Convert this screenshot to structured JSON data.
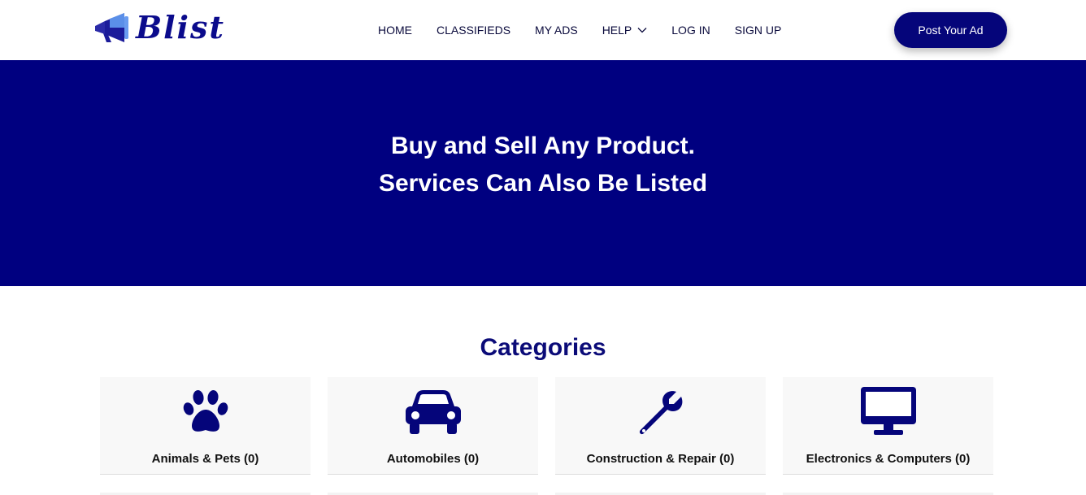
{
  "brand": {
    "name": "Blist",
    "color": "#0b0b8c"
  },
  "nav": {
    "items": [
      {
        "label": "HOME"
      },
      {
        "label": "CLASSIFIEDS"
      },
      {
        "label": "MY ADS"
      },
      {
        "label": "HELP"
      },
      {
        "label": "LOG IN"
      },
      {
        "label": "SIGN UP"
      }
    ],
    "post_button": "Post Your Ad"
  },
  "hero": {
    "line1": "Buy and Sell Any Product.",
    "line2": "Services Can Also Be Listed",
    "background": "#000080"
  },
  "categories": {
    "title": "Categories",
    "items": [
      {
        "label": "Animals & Pets (0)",
        "icon": "paw-icon"
      },
      {
        "label": "Automobiles (0)",
        "icon": "car-icon"
      },
      {
        "label": "Construction & Repair (0)",
        "icon": "wrench-icon"
      },
      {
        "label": "Electronics & Computers (0)",
        "icon": "monitor-icon"
      }
    ]
  }
}
